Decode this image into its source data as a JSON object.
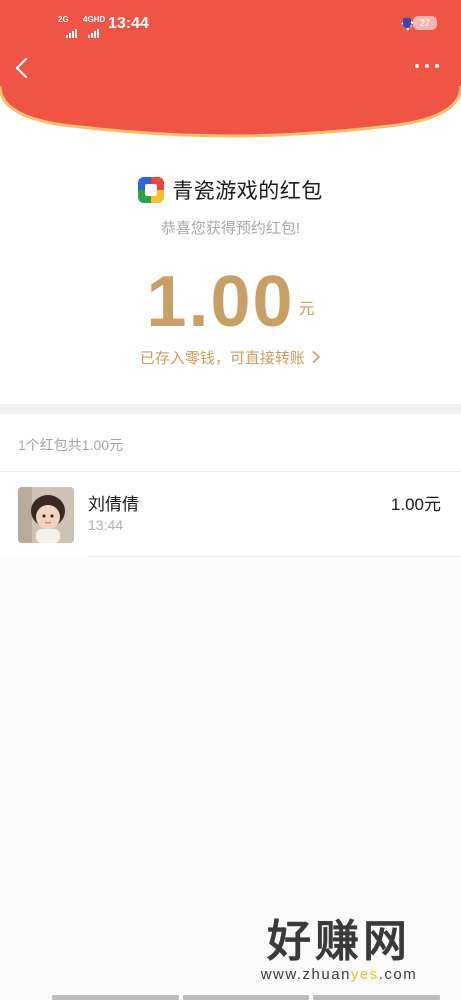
{
  "status_bar": {
    "signal_1": "2G",
    "signal_2": "4GHD",
    "time": "13:44",
    "battery": "27"
  },
  "header": {
    "accent_color": "#f05445"
  },
  "envelope": {
    "sender": "青瓷游戏的红包",
    "message": "恭喜您获得预约红包!",
    "amount": "1.00",
    "unit": "元",
    "deposit_text": "已存入零钱，可直接转账",
    "gold_color": "#c8a063"
  },
  "summary": "1个红包共1.00元",
  "records": [
    {
      "name": "刘倩倩",
      "time": "13:44",
      "amount": "1.00元"
    }
  ],
  "watermark": {
    "title": "好赚网",
    "url_prefix": "www.zhuan",
    "url_highlight": "yes",
    "url_suffix": ".com"
  }
}
